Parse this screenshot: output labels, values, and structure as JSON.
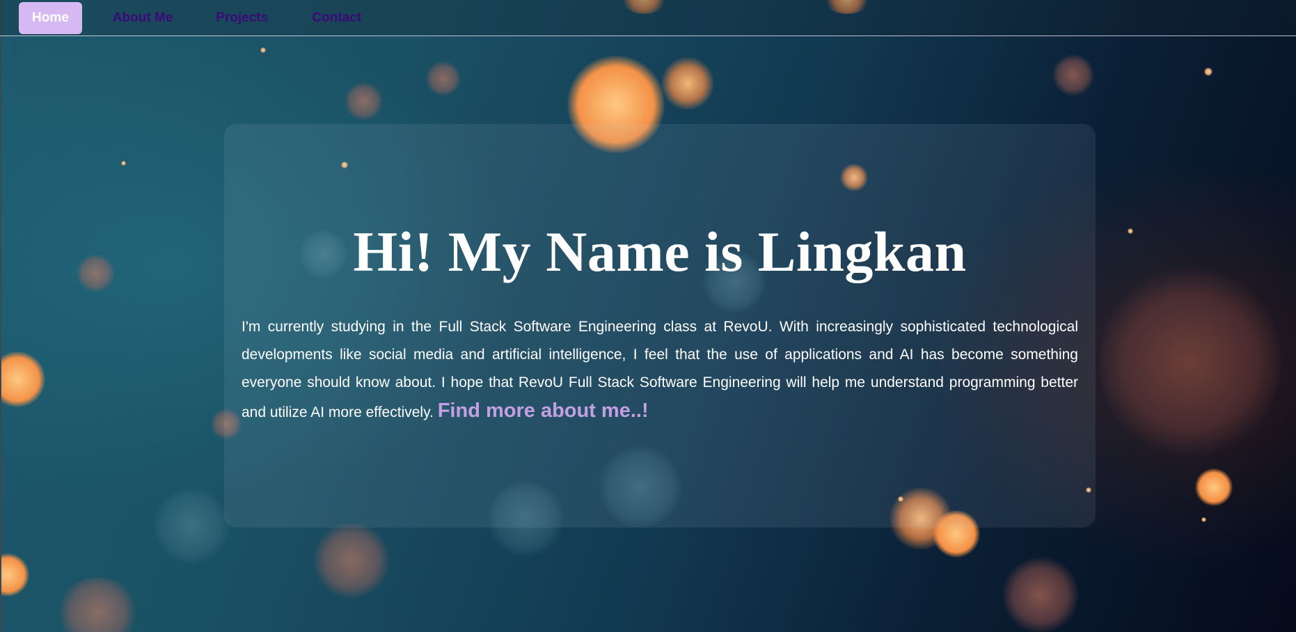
{
  "nav": {
    "items": [
      {
        "label": "Home",
        "active": true
      },
      {
        "label": "About Me",
        "active": false
      },
      {
        "label": "Projects",
        "active": false
      },
      {
        "label": "Contact",
        "active": false
      }
    ]
  },
  "hero": {
    "title": "Hi! My Name is Lingkan",
    "description": "I'm currently studying in the Full Stack Software Engineering class at RevoU. With increasingly sophisticated technological developments like social media and artificial intelligence, I feel that the use of applications and AI has become something everyone should know about. I hope that RevoU Full Stack Software Engineering will help me understand programming better and utilize AI more effectively.",
    "link_label": "Find more about me..!"
  },
  "colors": {
    "nav_active_bg": "#d6b8f2",
    "nav_text": "#3b0a7a",
    "link": "#c2a0e2",
    "text": "#ffffff"
  }
}
